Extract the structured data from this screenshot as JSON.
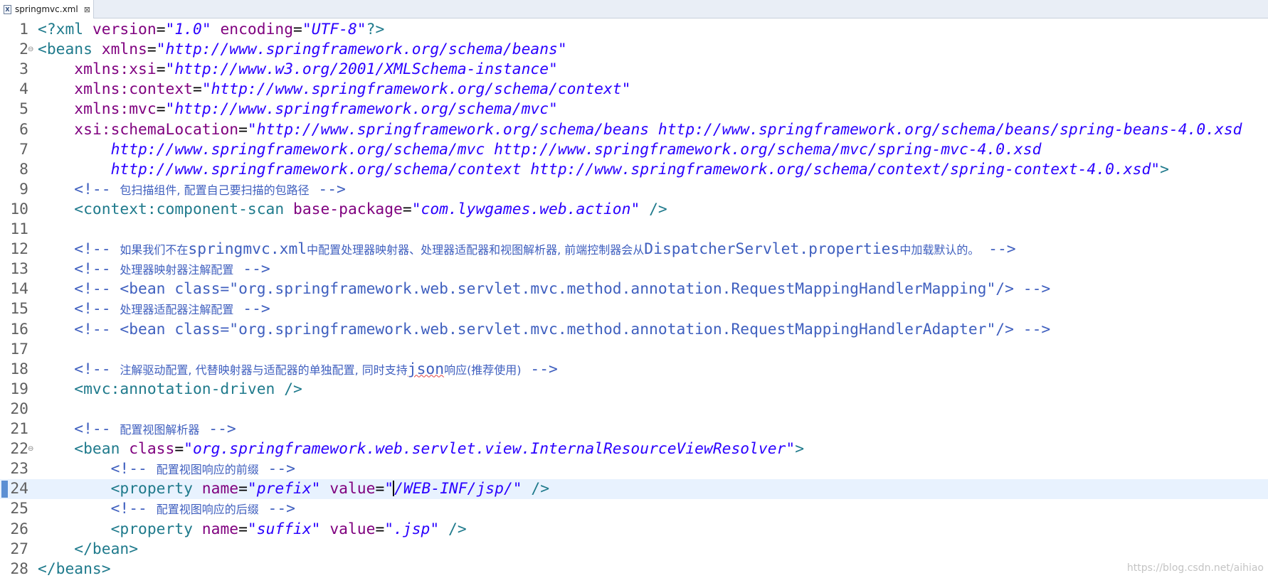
{
  "tab": {
    "title": "springmvc.xml",
    "icon": "xml-file-icon",
    "close": "⊠"
  },
  "lines": [
    [
      {
        "t": "<?xml ",
        "c": "tag"
      },
      {
        "t": "version",
        "c": "attr"
      },
      {
        "t": "=",
        "c": "eq"
      },
      {
        "t": "\"1.0\"",
        "c": "val"
      },
      {
        "t": " ",
        "c": "plain"
      },
      {
        "t": "encoding",
        "c": "attr"
      },
      {
        "t": "=",
        "c": "eq"
      },
      {
        "t": "\"UTF-8\"",
        "c": "val"
      },
      {
        "t": "?>",
        "c": "tag"
      }
    ],
    [
      {
        "t": "<beans ",
        "c": "tag"
      },
      {
        "t": "xmlns",
        "c": "attr"
      },
      {
        "t": "=",
        "c": "eq"
      },
      {
        "t": "\"http://www.springframework.org/schema/beans\"",
        "c": "val"
      }
    ],
    [
      {
        "t": "    ",
        "c": "plain"
      },
      {
        "t": "xmlns:xsi",
        "c": "attr"
      },
      {
        "t": "=",
        "c": "eq"
      },
      {
        "t": "\"http://www.w3.org/2001/XMLSchema-instance\"",
        "c": "val"
      }
    ],
    [
      {
        "t": "    ",
        "c": "plain"
      },
      {
        "t": "xmlns:context",
        "c": "attr"
      },
      {
        "t": "=",
        "c": "eq"
      },
      {
        "t": "\"http://www.springframework.org/schema/context\"",
        "c": "val"
      }
    ],
    [
      {
        "t": "    ",
        "c": "plain"
      },
      {
        "t": "xmlns:mvc",
        "c": "attr"
      },
      {
        "t": "=",
        "c": "eq"
      },
      {
        "t": "\"http://www.springframework.org/schema/mvc\"",
        "c": "val"
      }
    ],
    [
      {
        "t": "    ",
        "c": "plain"
      },
      {
        "t": "xsi:schemaLocation",
        "c": "attr"
      },
      {
        "t": "=",
        "c": "eq"
      },
      {
        "t": "\"http://www.springframework.org/schema/beans http://www.springframework.org/schema/beans/spring-beans-4.0.xsd",
        "c": "val"
      }
    ],
    [
      {
        "t": "        http://www.springframework.org/schema/mvc http://www.springframework.org/schema/mvc/spring-mvc-4.0.xsd",
        "c": "val"
      }
    ],
    [
      {
        "t": "        http://www.springframework.org/schema/context http://www.springframework.org/schema/context/spring-context-4.0.xsd\"",
        "c": "val"
      },
      {
        "t": ">",
        "c": "tag"
      }
    ],
    [
      {
        "t": "    <!-- ",
        "c": "comment"
      },
      {
        "t": "包扫描组件, 配置自己要扫描的包路径",
        "c": "comment cjk"
      },
      {
        "t": " -->",
        "c": "comment"
      }
    ],
    [
      {
        "t": "    <context:component-scan ",
        "c": "tag"
      },
      {
        "t": "base-package",
        "c": "attr"
      },
      {
        "t": "=",
        "c": "eq"
      },
      {
        "t": "\"com.lywgames.web.action\"",
        "c": "val"
      },
      {
        "t": " />",
        "c": "tag"
      }
    ],
    [],
    [
      {
        "t": "    <!-- ",
        "c": "comment"
      },
      {
        "t": "如果我们不在",
        "c": "comment cjk"
      },
      {
        "t": "springmvc.xml",
        "c": "comment"
      },
      {
        "t": "中配置处理器映射器、处理器适配器和视图解析器, 前端控制器会从",
        "c": "comment cjk"
      },
      {
        "t": "DispatcherServlet.properties",
        "c": "comment"
      },
      {
        "t": "中加载默认的。",
        "c": "comment cjk"
      },
      {
        "t": " -->",
        "c": "comment"
      }
    ],
    [
      {
        "t": "    <!-- ",
        "c": "comment"
      },
      {
        "t": "处理器映射器注解配置",
        "c": "comment cjk"
      },
      {
        "t": " -->",
        "c": "comment"
      }
    ],
    [
      {
        "t": "    <!-- <bean class=\"org.springframework.web.servlet.mvc.method.annotation.RequestMappingHandlerMapping\"/> -->",
        "c": "comment"
      }
    ],
    [
      {
        "t": "    <!-- ",
        "c": "comment"
      },
      {
        "t": "处理器适配器注解配置",
        "c": "comment cjk"
      },
      {
        "t": " -->",
        "c": "comment"
      }
    ],
    [
      {
        "t": "    <!-- <bean class=\"org.springframework.web.servlet.mvc.method.annotation.RequestMappingHandlerAdapter\"/> -->",
        "c": "comment"
      }
    ],
    [],
    [
      {
        "t": "    <!-- ",
        "c": "comment"
      },
      {
        "t": "注解驱动配置, 代替映射器与适配器的单独配置, 同时支持",
        "c": "comment cjk"
      },
      {
        "t": "json",
        "c": "comment squiggle"
      },
      {
        "t": "响应(推荐使用)",
        "c": "comment cjk"
      },
      {
        "t": " -->",
        "c": "comment"
      }
    ],
    [
      {
        "t": "    <mvc:annotation-driven />",
        "c": "tag"
      }
    ],
    [],
    [
      {
        "t": "    <!-- ",
        "c": "comment"
      },
      {
        "t": "配置视图解析器",
        "c": "comment cjk"
      },
      {
        "t": " -->",
        "c": "comment"
      }
    ],
    [
      {
        "t": "    <bean ",
        "c": "tag"
      },
      {
        "t": "class",
        "c": "attr"
      },
      {
        "t": "=",
        "c": "eq"
      },
      {
        "t": "\"org.springframework.web.servlet.view.InternalResourceViewResolver\"",
        "c": "val"
      },
      {
        "t": ">",
        "c": "tag"
      }
    ],
    [
      {
        "t": "        <!-- ",
        "c": "comment"
      },
      {
        "t": "配置视图响应的前缀",
        "c": "comment cjk"
      },
      {
        "t": " -->",
        "c": "comment"
      }
    ],
    [
      {
        "t": "        <property ",
        "c": "tag"
      },
      {
        "t": "name",
        "c": "attr"
      },
      {
        "t": "=",
        "c": "eq"
      },
      {
        "t": "\"prefix\"",
        "c": "val"
      },
      {
        "t": " ",
        "c": "plain"
      },
      {
        "t": "value",
        "c": "attr"
      },
      {
        "t": "=",
        "c": "eq"
      },
      {
        "t": "\"",
        "c": "val"
      },
      {
        "t": "",
        "c": "cursor"
      },
      {
        "t": "/WEB-INF/jsp/\"",
        "c": "val"
      },
      {
        "t": " />",
        "c": "tag"
      }
    ],
    [
      {
        "t": "        <!-- ",
        "c": "comment"
      },
      {
        "t": "配置视图响应的后缀",
        "c": "comment cjk"
      },
      {
        "t": " -->",
        "c": "comment"
      }
    ],
    [
      {
        "t": "        <property ",
        "c": "tag"
      },
      {
        "t": "name",
        "c": "attr"
      },
      {
        "t": "=",
        "c": "eq"
      },
      {
        "t": "\"suffix\"",
        "c": "val"
      },
      {
        "t": " ",
        "c": "plain"
      },
      {
        "t": "value",
        "c": "attr"
      },
      {
        "t": "=",
        "c": "eq"
      },
      {
        "t": "\".jsp\"",
        "c": "val"
      },
      {
        "t": " />",
        "c": "tag"
      }
    ],
    [
      {
        "t": "    </bean>",
        "c": "tag"
      }
    ],
    [
      {
        "t": "</beans>",
        "c": "tag"
      }
    ]
  ],
  "line_numbers": [
    "1",
    "2",
    "3",
    "4",
    "5",
    "6",
    "7",
    "8",
    "9",
    "10",
    "11",
    "12",
    "13",
    "14",
    "15",
    "16",
    "17",
    "18",
    "19",
    "20",
    "21",
    "22",
    "23",
    "24",
    "25",
    "26",
    "27",
    "28"
  ],
  "fold_lines": [
    2,
    22
  ],
  "current_line": 24,
  "watermark": "https://blog.csdn.net/aihiao",
  "colors": {
    "tag": "#1f7a8c",
    "attribute": "#7f007f",
    "value": "#2a00ff",
    "comment": "#3f5fbf",
    "current_line_bg": "#e8f2fe"
  }
}
